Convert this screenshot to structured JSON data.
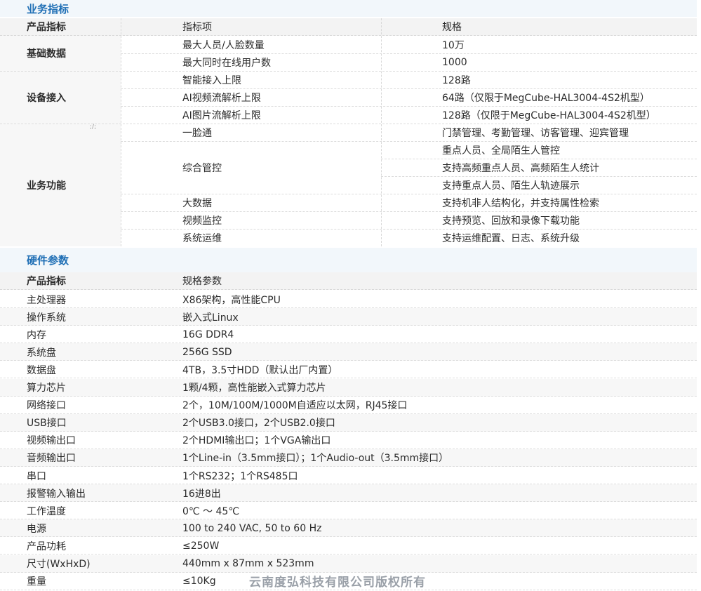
{
  "business": {
    "title": "业务指标",
    "headers": [
      "产品指标",
      "指标项",
      "规格"
    ],
    "groups": [
      {
        "name": "基础数据",
        "rows": [
          {
            "item": "最大人员/人脸数量",
            "spec": "10万"
          },
          {
            "item": "最大同时在线用户数",
            "spec": "1000"
          }
        ]
      },
      {
        "name": "设备接入",
        "rows": [
          {
            "item": "智能接入上限",
            "spec": "128路"
          },
          {
            "item": "AI视频流解析上限",
            "spec": "64路（仅限于MegCube-HAL3004-4S2机型）"
          },
          {
            "item": "AI图片流解析上限",
            "spec": "128路（仅限于MegCube-HAL3004-4S2机型）"
          }
        ]
      },
      {
        "name": "业务功能",
        "rows": [
          {
            "item": "一脸通",
            "spec": "门禁管理、考勤管理、访客管理、迎宾管理"
          },
          {
            "item": "综合管控",
            "specs": [
              "重点人员、全局陌生人管控",
              "支持高频重点人员、高频陌生人统计",
              "支持重点人员、陌生人轨迹展示"
            ]
          },
          {
            "item": "大数据",
            "spec": "支持机非人结构化，并支持属性检索"
          },
          {
            "item": "视频监控",
            "spec": "支持预览、回放和录像下载功能"
          },
          {
            "item": "系统运维",
            "spec": "支持运维配置、日志、系统升级"
          }
        ]
      }
    ]
  },
  "hardware": {
    "title": "硬件参数",
    "headers": [
      "产品指标",
      "规格参数"
    ],
    "rows": [
      {
        "name": "主处理器",
        "value": "X86架构，高性能CPU"
      },
      {
        "name": "操作系统",
        "value": "嵌入式Linux"
      },
      {
        "name": "内存",
        "value": "16G DDR4"
      },
      {
        "name": "系统盘",
        "value": "256G SSD"
      },
      {
        "name": "数据盘",
        "value": "4TB，3.5寸HDD（默认出厂内置）"
      },
      {
        "name": "算力芯片",
        "value": "1颗/4颗，高性能嵌入式算力芯片"
      },
      {
        "name": "网络接口",
        "value": "2个，10M/100M/1000M自适应以太网，RJ45接口"
      },
      {
        "name": "USB接口",
        "value": "2个USB3.0接口，2个USB2.0接口"
      },
      {
        "name": "视频输出口",
        "value": "2个HDMI输出口；1个VGA输出口"
      },
      {
        "name": "音频输出口",
        "value": "1个Line-in（3.5mm接口）；1个Audio-out（3.5mm接口）"
      },
      {
        "name": "串口",
        "value": "1个RS232；1个RS485口"
      },
      {
        "name": "报警输入输出",
        "value": "16进8出"
      },
      {
        "name": "工作温度",
        "value": "0℃ ～ 45℃"
      },
      {
        "name": "电源",
        "value": "100 to 240 VAC, 50 to 60 Hz"
      },
      {
        "name": "产品功耗",
        "value": "≤250W"
      },
      {
        "name": "尺寸(WxHxD)",
        "value": "440mm x 87mm x 523mm"
      },
      {
        "name": "重量",
        "value": "≤10Kg"
      }
    ]
  },
  "watermark": "云南度弘科技有限公司版权所有"
}
